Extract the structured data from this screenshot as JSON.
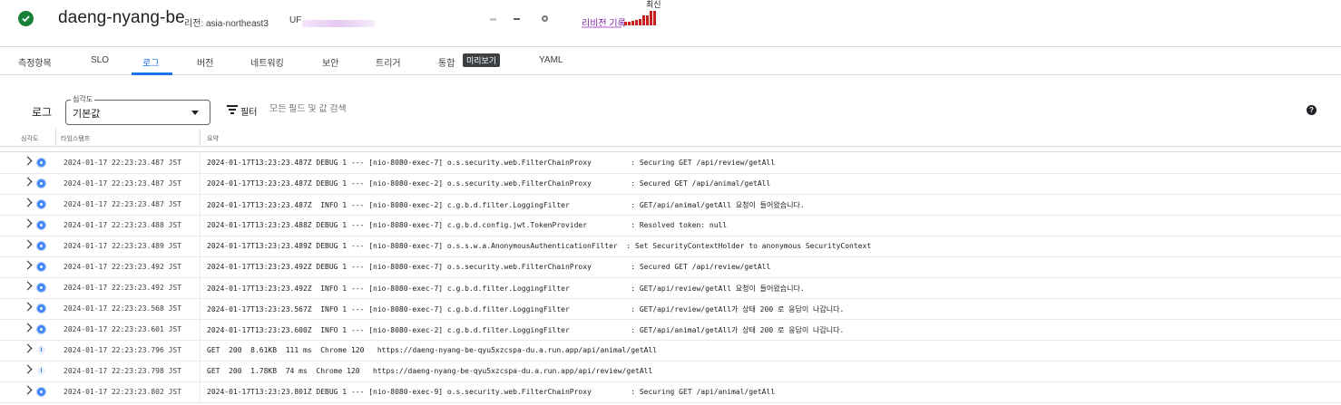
{
  "header": {
    "service_name": "daeng-nyang-be",
    "region": "리전: asia-northeast3",
    "url_label": "UF",
    "revision_history": "리비전 기록",
    "latest_label": "최신"
  },
  "tabs": [
    {
      "label": "측정항목"
    },
    {
      "label": "SLO"
    },
    {
      "label": "로그"
    },
    {
      "label": "버전"
    },
    {
      "label": "네트워킹"
    },
    {
      "label": "보안"
    },
    {
      "label": "트리거"
    },
    {
      "label": "통합"
    },
    {
      "label": "YAML"
    }
  ],
  "preview_chip": "미리보기",
  "active_tab": "로그",
  "toolbar": {
    "title": "로그",
    "severity_label": "심각도",
    "severity_value": "기본값",
    "filter_label": "필터",
    "filter_placeholder": "모든 필드 및 값 검색"
  },
  "columns": {
    "severity": "심각도",
    "timestamp": "타임스탬프",
    "summary": "요약"
  },
  "colors": {
    "accent": "#1a73e8",
    "success": "#188038",
    "revision": "#c5221f"
  },
  "logs": [
    {
      "severity": "debug",
      "timestamp": "2024-01-17 22:23:23.487 JST",
      "summary": "2024-01-17T13:23:23.487Z DEBUG 1 --- [nio-8080-exec-7] o.s.security.web.FilterChainProxy         : Securing GET /api/review/getAll"
    },
    {
      "severity": "debug",
      "timestamp": "2024-01-17 22:23:23.487 JST",
      "summary": "2024-01-17T13:23:23.487Z DEBUG 1 --- [nio-8080-exec-2] o.s.security.web.FilterChainProxy         : Secured GET /api/animal/getAll"
    },
    {
      "severity": "debug",
      "timestamp": "2024-01-17 22:23:23.487 JST",
      "summary": "2024-01-17T13:23:23.487Z  INFO 1 --- [nio-8080-exec-2] c.g.b.d.filter.LoggingFilter              : GET/api/animal/getAll 요청이 들어왔습니다."
    },
    {
      "severity": "debug",
      "timestamp": "2024-01-17 22:23:23.488 JST",
      "summary": "2024-01-17T13:23:23.488Z DEBUG 1 --- [nio-8080-exec-7] c.g.b.d.config.jwt.TokenProvider          : Resolved token: null"
    },
    {
      "severity": "debug",
      "timestamp": "2024-01-17 22:23:23.489 JST",
      "summary": "2024-01-17T13:23:23.489Z DEBUG 1 --- [nio-8080-exec-7] o.s.s.w.a.AnonymousAuthenticationFilter  : Set SecurityContextHolder to anonymous SecurityContext"
    },
    {
      "severity": "debug",
      "timestamp": "2024-01-17 22:23:23.492 JST",
      "summary": "2024-01-17T13:23:23.492Z DEBUG 1 --- [nio-8080-exec-7] o.s.security.web.FilterChainProxy         : Secured GET /api/review/getAll"
    },
    {
      "severity": "debug",
      "timestamp": "2024-01-17 22:23:23.492 JST",
      "summary": "2024-01-17T13:23:23.492Z  INFO 1 --- [nio-8080-exec-7] c.g.b.d.filter.LoggingFilter              : GET/api/review/getAll 요청이 들어왔습니다."
    },
    {
      "severity": "debug",
      "timestamp": "2024-01-17 22:23:23.568 JST",
      "summary": "2024-01-17T13:23:23.567Z  INFO 1 --- [nio-8080-exec-7] c.g.b.d.filter.LoggingFilter              : GET/api/review/getAll가 상태 200 로 응답이 나갑니다."
    },
    {
      "severity": "debug",
      "timestamp": "2024-01-17 22:23:23.601 JST",
      "summary": "2024-01-17T13:23:23.600Z  INFO 1 --- [nio-8080-exec-2] c.g.b.d.filter.LoggingFilter              : GET/api/animal/getAll가 상태 200 로 응답이 나갑니다."
    },
    {
      "severity": "info",
      "timestamp": "2024-01-17 22:23:23.796 JST",
      "summary": "GET  200  8.61KB  111 ms  Chrome 120   https://daeng-nyang-be-qyu5xzcspa-du.a.run.app/api/animal/getAll"
    },
    {
      "severity": "info",
      "timestamp": "2024-01-17 22:23:23.798 JST",
      "summary": "GET  200  1.78KB  74 ms  Chrome 120   https://daeng-nyang-be-qyu5xzcspa-du.a.run.app/api/review/getAll"
    },
    {
      "severity": "debug",
      "timestamp": "2024-01-17 22:23:23.802 JST",
      "summary": "2024-01-17T13:23:23.801Z DEBUG 1 --- [nio-8080-exec-9] o.s.security.web.FilterChainProxy         : Securing GET /api/animal/getAll"
    }
  ]
}
